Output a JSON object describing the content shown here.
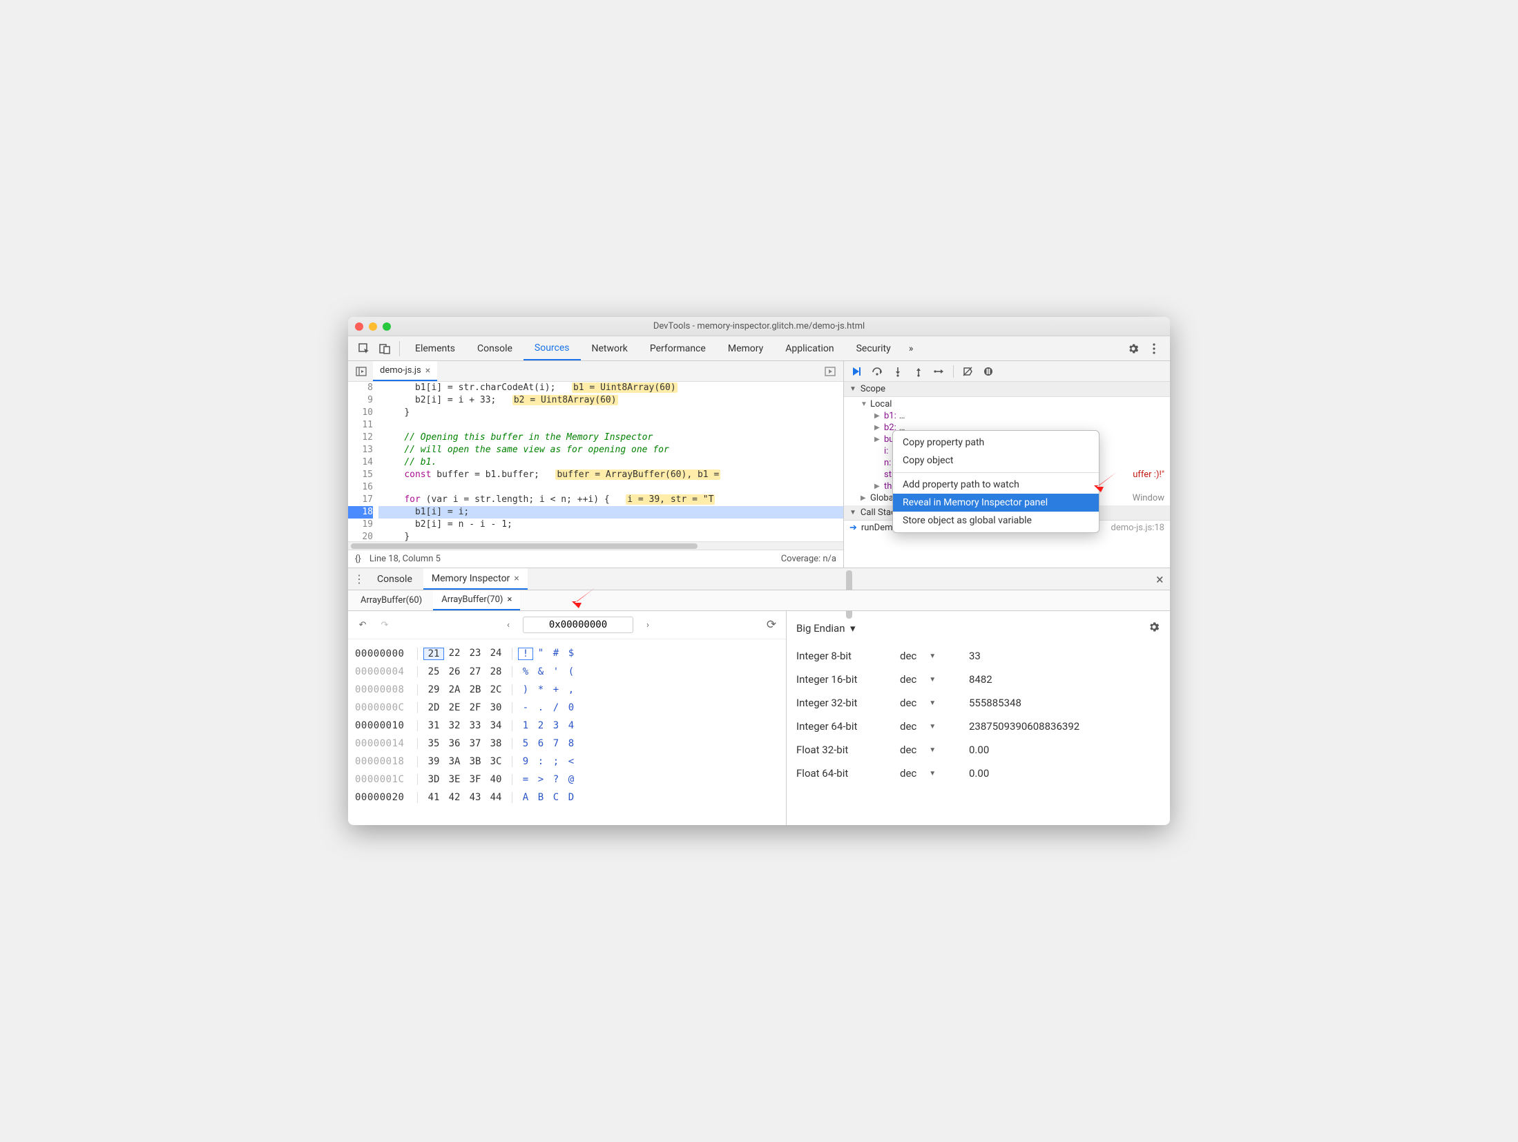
{
  "titlebar": {
    "title": "DevTools - memory-inspector.glitch.me/demo-js.html"
  },
  "main_tabs": {
    "items": [
      "Elements",
      "Console",
      "Sources",
      "Network",
      "Performance",
      "Memory",
      "Application",
      "Security"
    ],
    "active_index": 2,
    "overflow_glyph": "»"
  },
  "file_tab": {
    "name": "demo-js.js"
  },
  "editor": {
    "first_line": 8,
    "current_line": 18,
    "lines": {
      "l8": {
        "indent": "      ",
        "code": "b1[i] = str.charCodeAt(i);",
        "hint": "b1 = Uint8Array(60)"
      },
      "l9": {
        "indent": "      ",
        "code": "b2[i] = i + 33;",
        "hint": "b2 = Uint8Array(60)"
      },
      "l10": {
        "indent": "    ",
        "code": "}"
      },
      "l11": {
        "indent": "",
        "code": ""
      },
      "l12": {
        "indent": "    ",
        "comment": "// Opening this buffer in the Memory Inspector"
      },
      "l13": {
        "indent": "    ",
        "comment": "// will open the same view as for opening one for"
      },
      "l14": {
        "indent": "    ",
        "comment": "// b1."
      },
      "l15": {
        "indent": "    ",
        "kw": "const",
        "rest": " buffer = b1.buffer;",
        "hint": "buffer = ArrayBuffer(60), b1 ="
      },
      "l16": {
        "indent": "",
        "code": ""
      },
      "l17": {
        "indent": "    ",
        "kw": "for",
        "rest": " (var i = str.length; i < n; ++i) {",
        "hint": "i = 39, str = \"T"
      },
      "l18": {
        "indent": "      ",
        "code": "b1[i] = i;"
      },
      "l19": {
        "indent": "      ",
        "code": "b2[i] = n - i - 1;"
      },
      "l20": {
        "indent": "    ",
        "code": "}"
      },
      "l21": {
        "indent": "",
        "code": ""
      }
    },
    "status": {
      "braces": "{}",
      "pos": "Line 18, Column 5",
      "coverage": "Coverage: n/a"
    }
  },
  "scope": {
    "title": "Scope",
    "local_label": "Local",
    "rows": {
      "b1": {
        "key": "b1:",
        "val": "…"
      },
      "b2": {
        "key": "b2:",
        "val": "…"
      },
      "buf": {
        "key": "buf",
        "val": ""
      },
      "i": {
        "key": "i:",
        "val": ""
      },
      "n": {
        "key": "n:",
        "val": "("
      },
      "str": {
        "key": "str",
        "val": "uffer :)!\""
      },
      "this": {
        "key": "this",
        "val": ""
      }
    },
    "global_label": "Global",
    "global_right": "Window",
    "callstack_label": "Call Stack",
    "callstack": {
      "fn": "runDemo",
      "loc": "demo-js.js:18"
    }
  },
  "ctxmenu": {
    "items": [
      "Copy property path",
      "Copy object",
      "Add property path to watch",
      "Reveal in Memory Inspector panel",
      "Store object as global variable"
    ],
    "selected_index": 3
  },
  "drawer_tabs": {
    "items": [
      "Console",
      "Memory Inspector"
    ],
    "active_index": 1
  },
  "mi_tabs": {
    "items": [
      "ArrayBuffer(60)",
      "ArrayBuffer(70)"
    ],
    "active_index": 1
  },
  "mi_nav": {
    "address": "0x00000000"
  },
  "hex": {
    "rows": [
      {
        "addr": "00000000",
        "dim": false,
        "bytes": [
          "21",
          "22",
          "23",
          "24"
        ],
        "ascii": [
          "!",
          "\"",
          "#",
          "$"
        ],
        "sel": 0
      },
      {
        "addr": "00000004",
        "dim": true,
        "bytes": [
          "25",
          "26",
          "27",
          "28"
        ],
        "ascii": [
          "%",
          "&",
          "'",
          "("
        ]
      },
      {
        "addr": "00000008",
        "dim": true,
        "bytes": [
          "29",
          "2A",
          "2B",
          "2C"
        ],
        "ascii": [
          ")",
          "*",
          "+",
          ","
        ]
      },
      {
        "addr": "0000000C",
        "dim": true,
        "bytes": [
          "2D",
          "2E",
          "2F",
          "30"
        ],
        "ascii": [
          "-",
          ".",
          "/",
          "0"
        ]
      },
      {
        "addr": "00000010",
        "dim": false,
        "bytes": [
          "31",
          "32",
          "33",
          "34"
        ],
        "ascii": [
          "1",
          "2",
          "3",
          "4"
        ]
      },
      {
        "addr": "00000014",
        "dim": true,
        "bytes": [
          "35",
          "36",
          "37",
          "38"
        ],
        "ascii": [
          "5",
          "6",
          "7",
          "8"
        ]
      },
      {
        "addr": "00000018",
        "dim": true,
        "bytes": [
          "39",
          "3A",
          "3B",
          "3C"
        ],
        "ascii": [
          "9",
          ":",
          ";",
          "<"
        ]
      },
      {
        "addr": "0000001C",
        "dim": true,
        "bytes": [
          "3D",
          "3E",
          "3F",
          "40"
        ],
        "ascii": [
          "=",
          ">",
          "?",
          "@"
        ]
      },
      {
        "addr": "00000020",
        "dim": false,
        "bytes": [
          "41",
          "42",
          "43",
          "44"
        ],
        "ascii": [
          "A",
          "B",
          "C",
          "D"
        ]
      }
    ]
  },
  "interp": {
    "endian": "Big Endian",
    "rows": [
      {
        "label": "Integer 8-bit",
        "fmt": "dec",
        "val": "33"
      },
      {
        "label": "Integer 16-bit",
        "fmt": "dec",
        "val": "8482"
      },
      {
        "label": "Integer 32-bit",
        "fmt": "dec",
        "val": "555885348"
      },
      {
        "label": "Integer 64-bit",
        "fmt": "dec",
        "val": "2387509390608836392"
      },
      {
        "label": "Float 32-bit",
        "fmt": "dec",
        "val": "0.00"
      },
      {
        "label": "Float 64-bit",
        "fmt": "dec",
        "val": "0.00"
      }
    ]
  }
}
